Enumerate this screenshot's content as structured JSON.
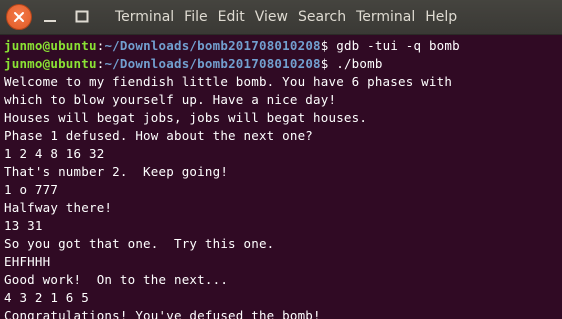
{
  "window": {
    "menu": [
      "Terminal",
      "File",
      "Edit",
      "View",
      "Search",
      "Terminal",
      "Help"
    ]
  },
  "terminal": {
    "prompts": [
      {
        "user_host": "junmo@ubuntu",
        "colon": ":",
        "path": "~/Downloads/bomb201708010208",
        "symbol": "$ ",
        "command": "gdb -tui -q bomb"
      },
      {
        "user_host": "junmo@ubuntu",
        "colon": ":",
        "path": "~/Downloads/bomb201708010208",
        "symbol": "$ ",
        "command": "./bomb"
      }
    ],
    "output": [
      "Welcome to my fiendish little bomb. You have 6 phases with",
      "which to blow yourself up. Have a nice day!",
      "Houses will begat jobs, jobs will begat houses.",
      "Phase 1 defused. How about the next one?",
      "1 2 4 8 16 32",
      "That's number 2.  Keep going!",
      "1 o 777",
      "Halfway there!",
      "13 31",
      "So you got that one.  Try this one.",
      "EHFHHH",
      "Good work!  On to the next...",
      "4 3 2 1 6 5",
      "Congratulations! You've defused the bomb!"
    ]
  },
  "colors": {
    "terminal_bg": "#300a24",
    "prompt_user": "#8ae234",
    "prompt_path": "#729fcf",
    "close_button": "#e95420"
  },
  "icons": [
    "close-icon",
    "minimize-icon",
    "maximize-icon"
  ]
}
